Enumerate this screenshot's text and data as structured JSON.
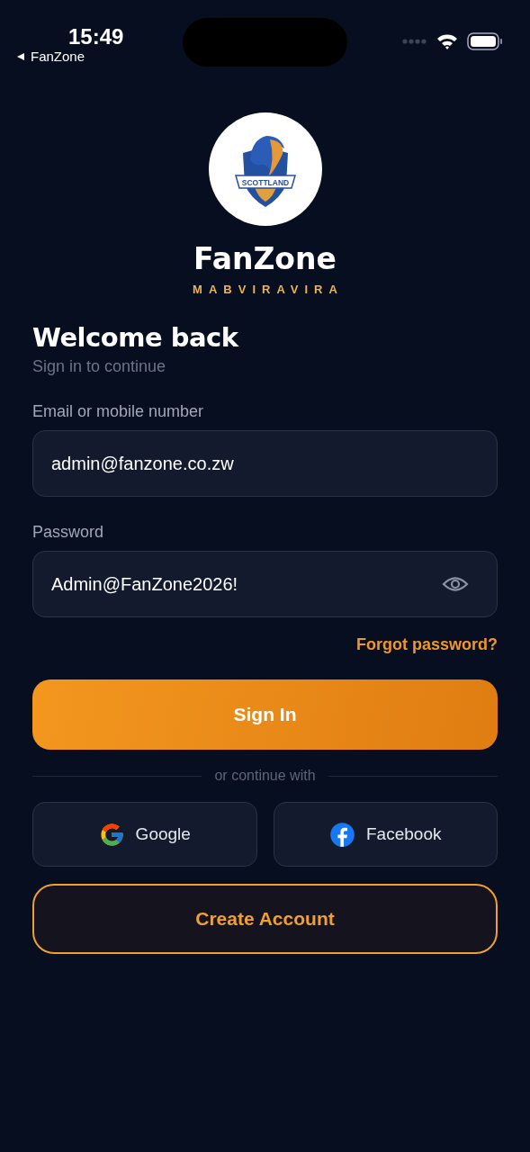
{
  "status_bar": {
    "time": "15:49",
    "back_label": "FanZone"
  },
  "brand": {
    "logo_text": "SCOTTLAND",
    "name": "FanZone",
    "tagline": "MABVIRAVIRA"
  },
  "heading": {
    "title": "Welcome back",
    "subtitle": "Sign in to continue"
  },
  "fields": [
    {
      "kind": "text",
      "label": "Email or mobile number",
      "value": "admin@fanzone.co.zw"
    },
    {
      "kind": "password",
      "label": "Password",
      "value": "Admin@FanZone2026!"
    }
  ],
  "forgot_link": "Forgot password?",
  "sign_in_button": "Sign In",
  "divider_text": "or continue with",
  "social_buttons": [
    {
      "kind": "google",
      "label": "Google"
    },
    {
      "kind": "facebook",
      "label": "Facebook"
    }
  ],
  "create_account_button": "Create Account"
}
